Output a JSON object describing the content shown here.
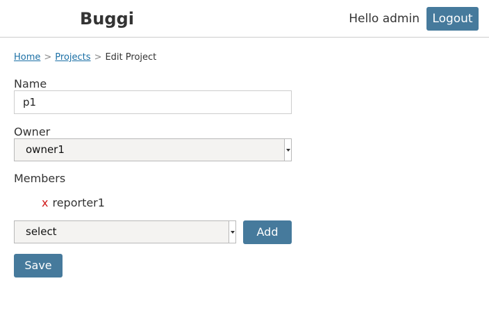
{
  "header": {
    "brand": "Buggi",
    "greeting": "Hello admin",
    "logout_label": "Logout"
  },
  "breadcrumb": {
    "home": "Home",
    "separator": ">",
    "projects": "Projects",
    "current": "Edit Project"
  },
  "form": {
    "name_label": "Name",
    "name_value": "p1",
    "owner_label": "Owner",
    "owner_selected": "owner1",
    "members_label": "Members",
    "members": [
      {
        "remove_label": "x",
        "name": "reporter1"
      }
    ],
    "member_select": "select",
    "add_label": "Add",
    "save_label": "Save"
  },
  "colors": {
    "button": "#467a9c",
    "remove": "#d01818",
    "link": "#1a6fa5"
  }
}
